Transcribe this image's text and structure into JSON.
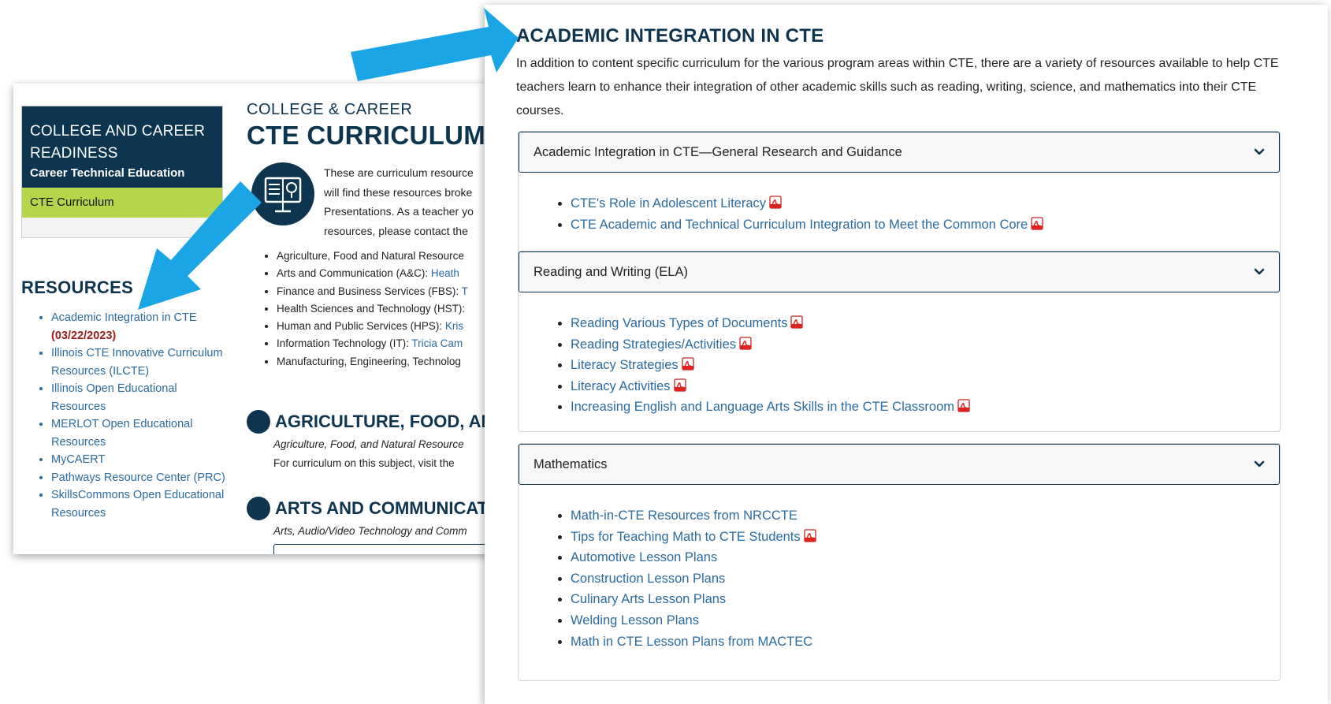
{
  "back_page": {
    "sidebar": {
      "title": "COLLEGE AND CAREER READINESS",
      "subtitle": "Career Technical Education",
      "active_item": "CTE Curriculum"
    },
    "resources": {
      "heading": "RESOURCES",
      "items": [
        {
          "label": "Academic Integration in CTE",
          "date": "(03/22/2023)"
        },
        {
          "label": "Illinois CTE Innovative Curriculum Resources (ILCTE)"
        },
        {
          "label": "Illinois Open Educational Resources"
        },
        {
          "label": "MERLOT Open Educational Resources"
        },
        {
          "label": "MyCAERT"
        },
        {
          "label": "Pathways Resource Center (PRC)"
        },
        {
          "label": "SkillsCommons Open Educational Resources"
        }
      ]
    },
    "main": {
      "eyebrow": "COLLEGE & CAREER",
      "title": "CTE CURRICULUM",
      "intro_lines": [
        "These are curriculum resource",
        "will find these resources broke",
        "Presentations. As a teacher yo",
        "resources, please contact the"
      ],
      "program_areas": [
        {
          "text": "Agriculture, Food and Natural Resource",
          "link": ""
        },
        {
          "text": "Arts and Communication (A&C): ",
          "link": "Heath"
        },
        {
          "text": "Finance and Business Services (FBS): ",
          "link": "T"
        },
        {
          "text": "Health Sciences and Technology (HST):",
          "link": ""
        },
        {
          "text": "Human and Public Services (HPS): ",
          "link": "Kris"
        },
        {
          "text": "Information Technology (IT): ",
          "link": "Tricia Cam"
        },
        {
          "text": "Manufacturing, Engineering, Technolog",
          "link": ""
        }
      ],
      "section1": {
        "heading": "AGRICULTURE, FOOD, AND NAT",
        "subtitle": "Agriculture, Food, and Natural Resource",
        "text": "For curriculum on this subject, visit the"
      },
      "section2": {
        "heading": "ARTS AND COMMUNICATION (A",
        "subtitle": "Arts, Audio/Video Technology and Comm"
      }
    }
  },
  "front_page": {
    "title": "ACADEMIC INTEGRATION IN CTE",
    "intro": "In addition to content specific curriculum for the various program areas within CTE, there are a variety of resources available to help CTE teachers learn to enhance their integration of other academic skills such as reading, writing, science, and mathematics into their CTE courses.",
    "accordions": [
      {
        "header": "Academic Integration in CTE—General Research and Guidance",
        "items": [
          {
            "label": "CTE's Role in Adolescent Literacy",
            "pdf": true
          },
          {
            "label": "CTE Academic and Technical Curriculum Integration to Meet the Common Core",
            "pdf": true
          }
        ]
      },
      {
        "header": "Reading and Writing (ELA)",
        "items": [
          {
            "label": "Reading Various Types of Documents",
            "pdf": true
          },
          {
            "label": "Reading Strategies/Activities",
            "pdf": true
          },
          {
            "label": "Literacy Strategies",
            "pdf": true
          },
          {
            "label": "Literacy Activities",
            "pdf": true
          },
          {
            "label": "Increasing English and Language Arts Skills in the CTE Classroom",
            "pdf": true
          }
        ]
      },
      {
        "header": "Mathematics",
        "items": [
          {
            "label": "Math-in-CTE Resources from NRCCTE",
            "pdf": false
          },
          {
            "label": "Tips for Teaching Math to CTE Students",
            "pdf": true
          },
          {
            "label": "Automotive Lesson Plans",
            "pdf": false
          },
          {
            "label": "Construction Lesson Plans",
            "pdf": false
          },
          {
            "label": "Culinary Arts Lesson Plans",
            "pdf": false
          },
          {
            "label": "Welding Lesson Plans",
            "pdf": false
          },
          {
            "label": "Math in CTE Lesson Plans from MACTEC",
            "pdf": false
          }
        ]
      }
    ]
  },
  "colors": {
    "navy": "#0d3550",
    "green": "#b5d64a",
    "link": "#2a6ba0",
    "arrow": "#1aa5e6",
    "date": "#a01c1c"
  },
  "icons": [
    "pdf-icon",
    "chevron-down-icon",
    "curriculum-book-icon",
    "agriculture-icon",
    "arts-icon",
    "callout-arrow"
  ]
}
